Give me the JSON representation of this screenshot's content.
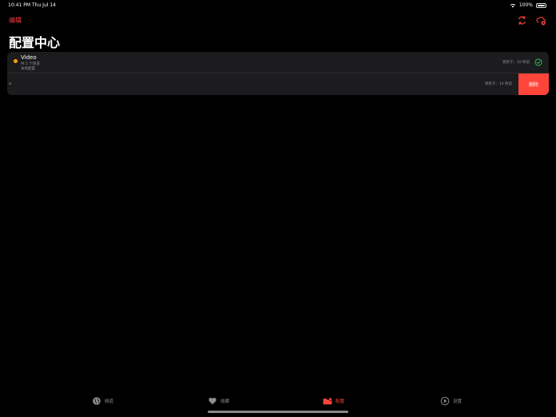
{
  "status_bar": {
    "time": "10:41 PM",
    "date": "Thu Jul 14",
    "battery": "100%"
  },
  "nav": {
    "edit_label": "编辑"
  },
  "page": {
    "title": "配置中心"
  },
  "config_list": {
    "item1": {
      "title": "Video",
      "line1": "共 5 个频道",
      "line2": "本地配置",
      "updated": "更新于：10 秒前"
    },
    "item2": {
      "mark": "a",
      "updated": "更新于：10 秒前",
      "delete_label": "删除"
    }
  },
  "tabs": [
    {
      "label": "频道",
      "icon": "globe-icon"
    },
    {
      "label": "收藏",
      "icon": "heart-icon"
    },
    {
      "label": "配置",
      "icon": "folder-icon"
    },
    {
      "label": "设置",
      "icon": "play-circle-icon"
    }
  ],
  "colors": {
    "accent": "#ff453a",
    "background": "#000000",
    "card": "#1c1c1e",
    "status_dot": "#ff9f0a",
    "check": "#34c759"
  }
}
